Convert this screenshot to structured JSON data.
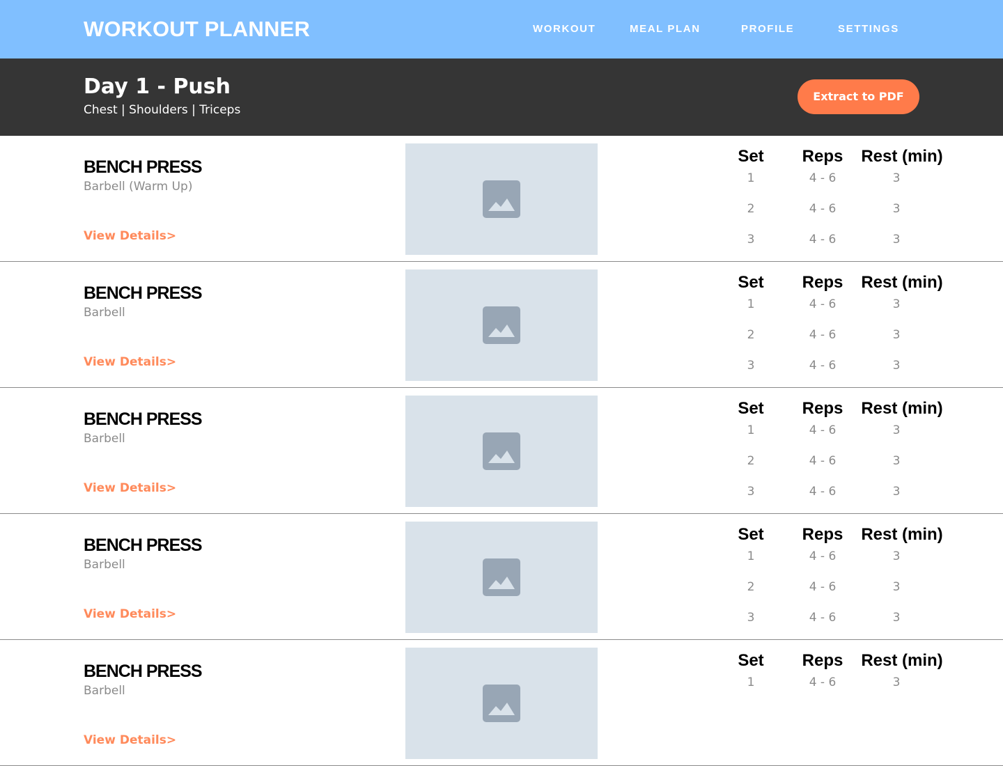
{
  "header": {
    "brand": "WORKOUT PLANNER",
    "nav": [
      "WORKOUT",
      "MEAL PLAN",
      "PROFILE",
      "SETTINGS"
    ]
  },
  "hero": {
    "title": "Day 1 - Push",
    "subtitle": "Chest | Shoulders | Triceps",
    "button_label": "Extract to PDF"
  },
  "table_headers": {
    "set": "Set",
    "reps": "Reps",
    "rest": "Rest (min)"
  },
  "exercises": [
    {
      "name": "BENCH PRESS",
      "equipment": "Barbell (Warm Up)",
      "details_label": "View Details>",
      "rows": [
        {
          "set": "1",
          "reps": "4 - 6",
          "rest": "3"
        },
        {
          "set": "2",
          "reps": "4 - 6",
          "rest": "3"
        },
        {
          "set": "3",
          "reps": "4 - 6",
          "rest": "3"
        }
      ]
    },
    {
      "name": "BENCH PRESS",
      "equipment": "Barbell",
      "details_label": "View Details>",
      "rows": [
        {
          "set": "1",
          "reps": "4 - 6",
          "rest": "3"
        },
        {
          "set": "2",
          "reps": "4 - 6",
          "rest": "3"
        },
        {
          "set": "3",
          "reps": "4 - 6",
          "rest": "3"
        }
      ]
    },
    {
      "name": "BENCH PRESS",
      "equipment": "Barbell",
      "details_label": "View Details>",
      "rows": [
        {
          "set": "1",
          "reps": "4 - 6",
          "rest": "3"
        },
        {
          "set": "2",
          "reps": "4 - 6",
          "rest": "3"
        },
        {
          "set": "3",
          "reps": "4 - 6",
          "rest": "3"
        }
      ]
    },
    {
      "name": "BENCH PRESS",
      "equipment": "Barbell",
      "details_label": "View Details>",
      "rows": [
        {
          "set": "1",
          "reps": "4 - 6",
          "rest": "3"
        },
        {
          "set": "2",
          "reps": "4 - 6",
          "rest": "3"
        },
        {
          "set": "3",
          "reps": "4 - 6",
          "rest": "3"
        }
      ]
    },
    {
      "name": "BENCH PRESS",
      "equipment": "Barbell",
      "details_label": "View Details>",
      "rows": [
        {
          "set": "1",
          "reps": "4 - 6",
          "rest": "3"
        }
      ]
    }
  ],
  "icons": {
    "exercise_image": "image-placeholder-icon"
  },
  "colors": {
    "header_bg": "#80bfff",
    "hero_bg": "#353535",
    "accent": "#ff7b4a",
    "link": "#ff8a5b",
    "image_bg": "#d9e2ea",
    "image_icon": "#98a6b5"
  }
}
